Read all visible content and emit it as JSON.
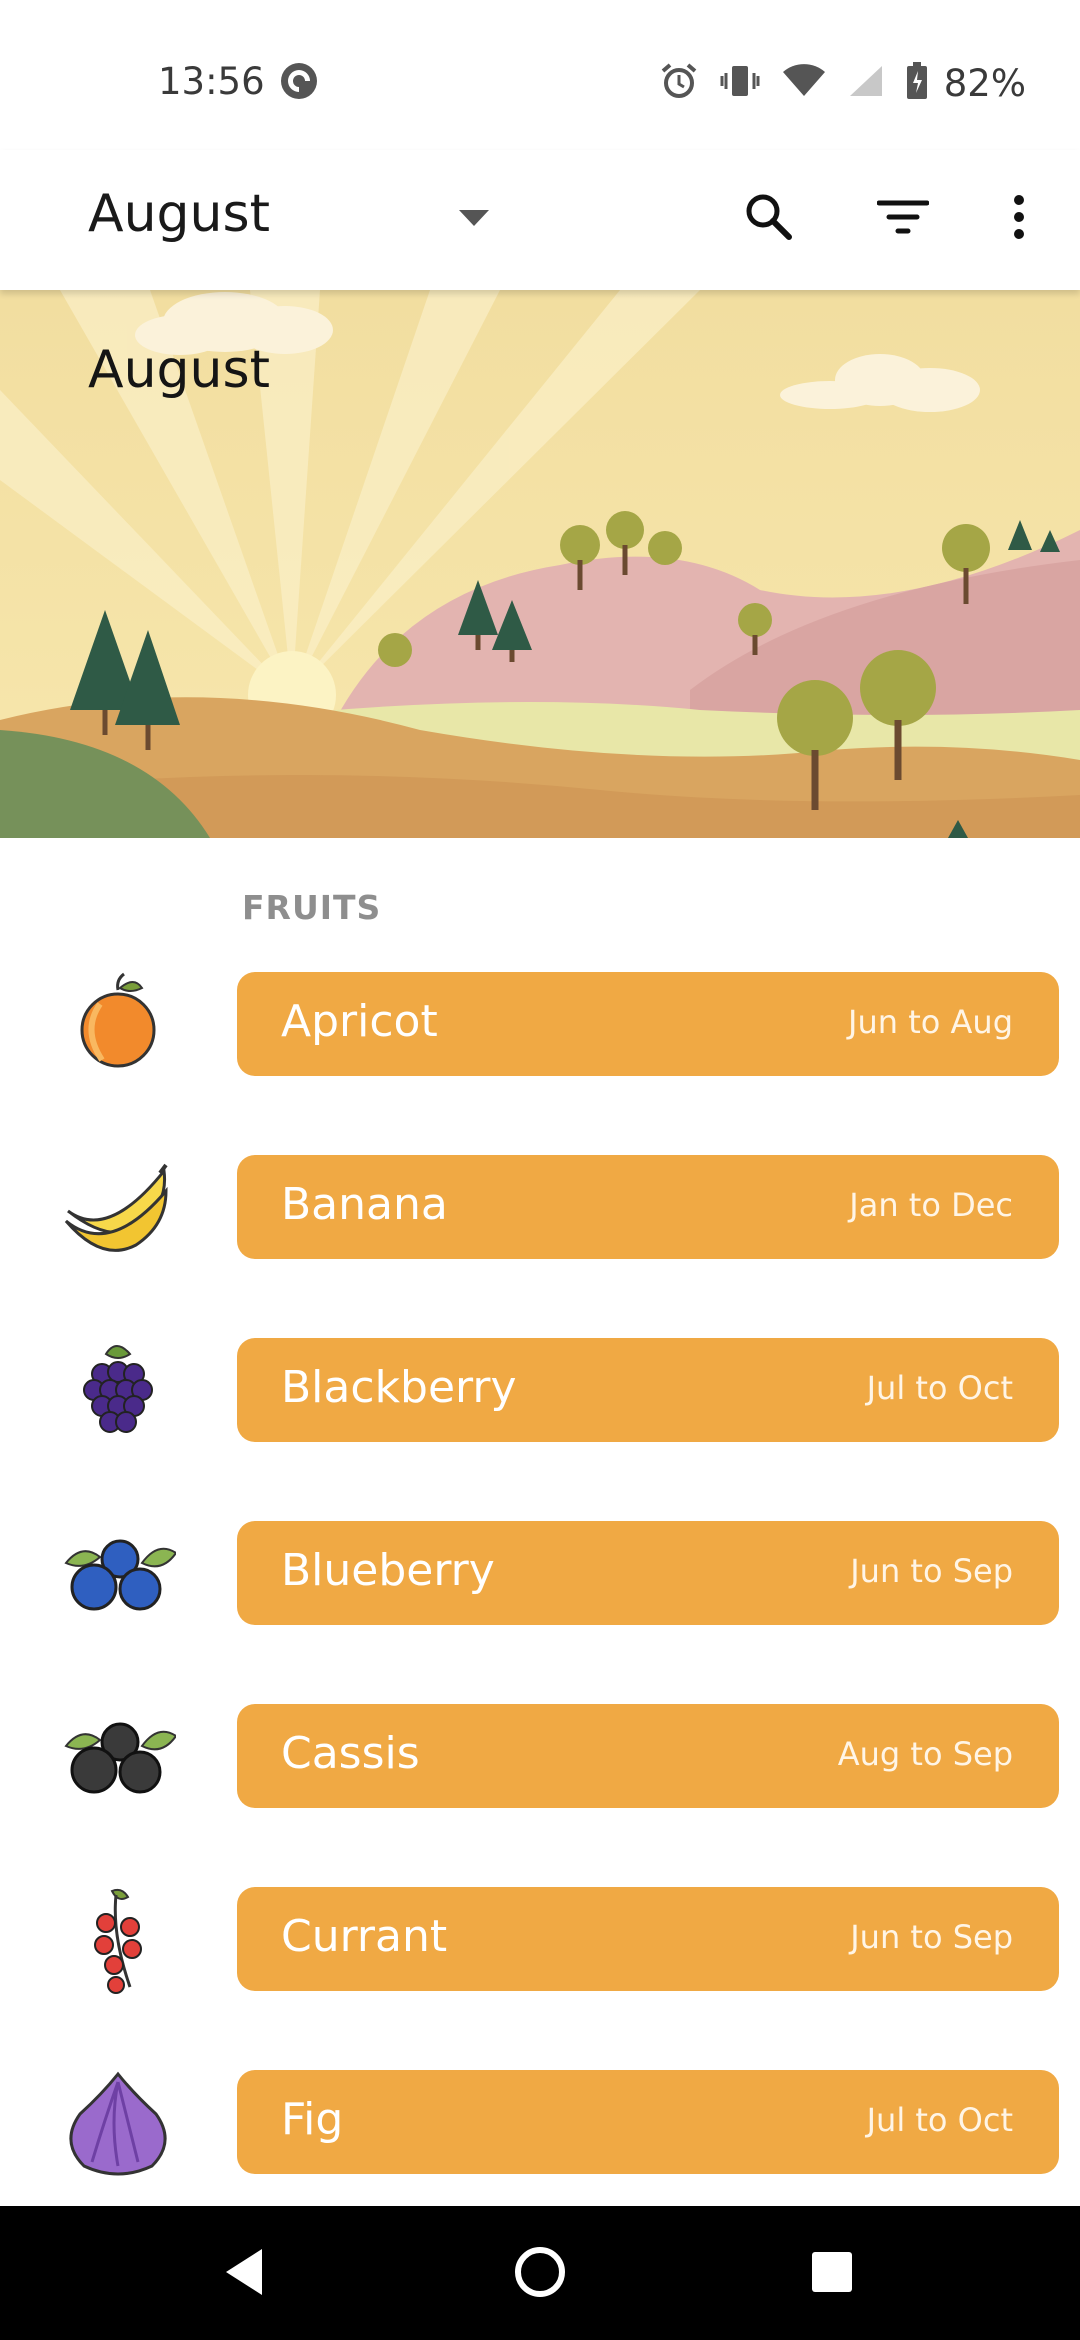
{
  "status_bar": {
    "time": "13:56",
    "battery_percent": "82%",
    "icons": [
      "pocket-casts-icon",
      "alarm-icon",
      "vibrate-icon",
      "wifi-icon",
      "cellular-signal-icon",
      "battery-charging-icon"
    ]
  },
  "toolbar": {
    "title": "August",
    "actions": [
      "search-icon",
      "filter-icon",
      "more-vert-icon"
    ]
  },
  "banner": {
    "title": "August"
  },
  "list": {
    "section_header": "FRUITS",
    "items": [
      {
        "name": "Apricot",
        "season": "Jun to Aug",
        "icon": "apricot-icon"
      },
      {
        "name": "Banana",
        "season": "Jan to Dec",
        "icon": "banana-icon"
      },
      {
        "name": "Blackberry",
        "season": "Jul to Oct",
        "icon": "blackberry-icon"
      },
      {
        "name": "Blueberry",
        "season": "Jun to Sep",
        "icon": "blueberry-icon"
      },
      {
        "name": "Cassis",
        "season": "Aug to Sep",
        "icon": "cassis-icon"
      },
      {
        "name": "Currant",
        "season": "Jun to Sep",
        "icon": "currant-icon"
      },
      {
        "name": "Fig",
        "season": "Jul to Oct",
        "icon": "fig-icon"
      }
    ]
  },
  "nav_bar": {
    "buttons": [
      "back-icon",
      "home-icon",
      "recents-icon"
    ]
  },
  "colors": {
    "pill": "#f0a944",
    "section_header": "#8e8e8e",
    "nav_bar": "#000000"
  }
}
